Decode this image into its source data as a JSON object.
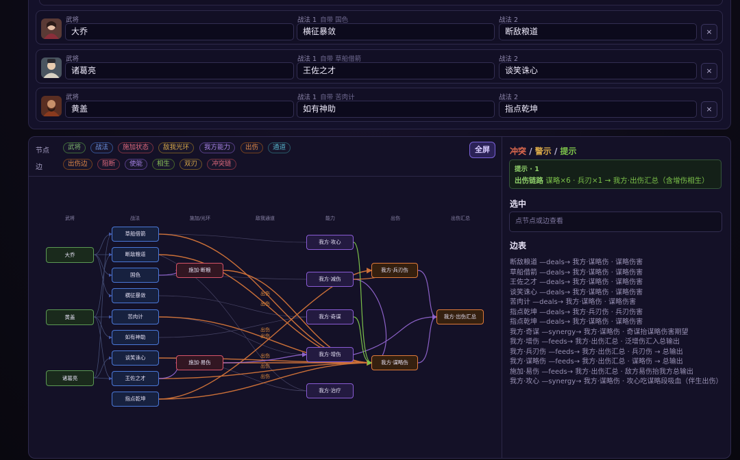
{
  "team": {
    "rows": [
      {
        "label_general": "武将",
        "general": "大乔",
        "label_skill1": "战法 1",
        "skill1_sub": "自带 国色",
        "skill1": "横征暴敛",
        "label_skill2": "战法 2",
        "skill2": "断敌粮道",
        "remove": "×"
      },
      {
        "label_general": "武将",
        "general": "诸葛亮",
        "label_skill1": "战法 1",
        "skill1_sub": "自带 草船借箭",
        "skill1": "王佐之才",
        "label_skill2": "战法 2",
        "skill2": "谈笑诛心",
        "remove": "×"
      },
      {
        "label_general": "武将",
        "general": "黄盖",
        "label_skill1": "战法 1",
        "skill1_sub": "自带 苦肉计",
        "skill1": "如有神助",
        "label_skill2": "战法 2",
        "skill2": "指点乾坤",
        "remove": "×"
      }
    ]
  },
  "graph": {
    "node_label": "节点",
    "edge_label": "边",
    "node_chips": [
      "武将",
      "战法",
      "施加状态",
      "敌我光环",
      "我方能力",
      "出伤",
      "通道"
    ],
    "edge_chips": [
      "出伤边",
      "阻断",
      "使能",
      "相生",
      "双刃",
      "冲突链"
    ],
    "fullscreen": "全屏",
    "columns": [
      "武将",
      "战法",
      "施加/光环",
      "敌我通道",
      "能力",
      "出伤",
      "出伤汇总"
    ],
    "nodes": {
      "daqiao": "大乔",
      "huanggai": "黄盖",
      "zhugeliang": "诸葛亮",
      "caochuan": "草船借箭",
      "duandi": "断敌粮道",
      "guose": "国色",
      "hengzheng": "横征暴敛",
      "kurouji": "苦肉计",
      "youru": "如有神助",
      "tanxiao": "谈笑诛心",
      "wangzuo": "王佐之才",
      "zhidian": "指点乾坤",
      "shijia_duanliang": "施加·断粮",
      "shijia_yishang": "施加·易伤",
      "gongxin": "我方·攻心",
      "jianshang": "我方·减伤",
      "qimou": "我方·奇谋",
      "zengshang": "我方·增伤",
      "zhiliao": "我方·治疗",
      "bingren": "我方·兵刃伤",
      "moushang": "我方·谋略伤",
      "huizong": "我方·出伤汇总"
    },
    "edge_label_text": "出伤"
  },
  "panel": {
    "conflict_title": {
      "a": "冲突",
      "sep1": " / ",
      "b": "警示",
      "sep2": " / ",
      "c": "提示"
    },
    "hint_header": "提示 · 1",
    "hint_key": "出伤链路",
    "hint_text": "谋略×6 · 兵刃×1 → 我方·出伤汇总（含增伤相生）",
    "selected_title": "选中",
    "selected_placeholder": "点节点或边查看",
    "edges_title": "边表",
    "edges": [
      "断敌粮道 —deals→ 我方·谋略伤 · 谋略伤害",
      "草船借箭 —deals→ 我方·谋略伤 · 谋略伤害",
      "王佐之才 —deals→ 我方·谋略伤 · 谋略伤害",
      "谈笑诛心 —deals→ 我方·谋略伤 · 谋略伤害",
      "苦肉计 —deals→ 我方·谋略伤 · 谋略伤害",
      "指点乾坤 —deals→ 我方·兵刃伤 · 兵刃伤害",
      "指点乾坤 —deals→ 我方·谋略伤 · 谋略伤害",
      "我方·奇谋 —synergy→ 我方·谋略伤 · 奇谋抬谋略伤害期望",
      "我方·增伤 —feeds→ 我方·出伤汇总 · 泛增伤汇入总输出",
      "我方·兵刃伤 —feeds→ 我方·出伤汇总 · 兵刃伤 → 总输出",
      "我方·谋略伤 —feeds→ 我方·出伤汇总 · 谋略伤 → 总输出",
      "施加·易伤 —feeds→ 我方·出伤汇总 · 敌方易伤抬我方总输出",
      "我方·攻心 —synergy→ 我方·谋略伤 · 攻心吃谋略段吸血（伴生出伤）"
    ]
  },
  "colors": {
    "general": "#6fa86a",
    "skill": "#4a78d8",
    "status": "#d8546a",
    "aura": "#d8a040",
    "ability": "#8b5cd6",
    "damage": "#e07b3a",
    "channel": "#3aa0b8",
    "edge_damage": "#e07b3a",
    "edge_enable": "#9b6bdb",
    "edge_synergy": "#7cc24a"
  },
  "icons": {
    "remove": "close-icon"
  }
}
